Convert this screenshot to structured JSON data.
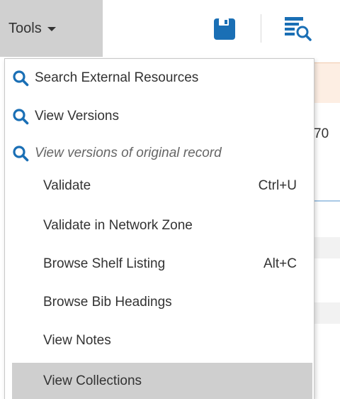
{
  "toolbar": {
    "tools_label": "Tools",
    "icons": {
      "save": "floppy-disk-icon",
      "view": "list-search-icon"
    },
    "accent_color": "#1a6fb5"
  },
  "background": {
    "partial_text": "70"
  },
  "menu": {
    "items": [
      {
        "label": "Search External Resources",
        "icon": "search-icon",
        "shortcut": ""
      },
      {
        "label": "View Versions",
        "icon": "search-icon",
        "shortcut": ""
      },
      {
        "label": "View versions of original record",
        "icon": "search-icon",
        "shortcut": "",
        "style": "italic"
      },
      {
        "label": "Validate",
        "shortcut": "Ctrl+U"
      },
      {
        "label": "Validate in Network Zone",
        "shortcut": ""
      },
      {
        "label": "Browse Shelf Listing",
        "shortcut": "Alt+C"
      },
      {
        "label": "Browse Bib Headings",
        "shortcut": ""
      },
      {
        "label": "View Notes",
        "shortcut": ""
      },
      {
        "label": "View Collections",
        "shortcut": "",
        "state": "highlighted"
      }
    ]
  }
}
